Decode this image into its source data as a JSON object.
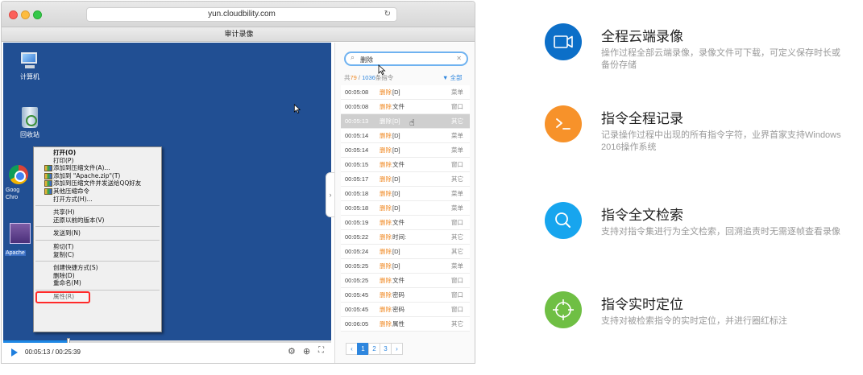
{
  "browser": {
    "url": "yun.cloudbility.com",
    "window_title": "审计录像"
  },
  "desktop": {
    "icons": {
      "computer": "计算机",
      "recycle_bin": "回收站",
      "chrome": "Goog\nChro",
      "zip": "Apache"
    },
    "context_menu": {
      "open": "打开(O)",
      "print": "打印(P)",
      "add_archive": "添加到压缩文件(A)...",
      "add_apache_zip": "添加到 \"Apache.zip\"(T)",
      "add_send_qq": "添加到压缩文件并发送给QQ好友",
      "other_compress": "其他压缩命令",
      "open_with": "打开方式(H)...",
      "share": "共享(H)",
      "restore": "还原以前的版本(V)",
      "send_to": "发送到(N)",
      "cut": "剪切(T)",
      "copy": "复制(C)",
      "create_shortcut": "创建快捷方式(S)",
      "delete": "删除(D)",
      "rename": "重命名(M)",
      "properties": "属性(R)"
    }
  },
  "player": {
    "time": "00:05:13 / 00:25:39",
    "progress_fraction": 0.2,
    "controls": [
      "settings-icon",
      "zoom-icon",
      "fullscreen-icon"
    ]
  },
  "panel": {
    "search_value": "删除",
    "stats_prefix": "共",
    "stats_match": "79",
    "stats_sep": " / ",
    "stats_total": "1036",
    "stats_suffix": "条指令",
    "filter_label": "全部",
    "commands": [
      {
        "time": "00:05:08",
        "keyword": "删除",
        "suffix": "[D]",
        "category": "菜单"
      },
      {
        "time": "00:05:08",
        "keyword": "删除",
        "suffix": "文件",
        "category": "窗口"
      },
      {
        "time": "00:05:13",
        "keyword": "删除",
        "suffix": "[D]",
        "category": "其它",
        "selected": true
      },
      {
        "time": "00:05:14",
        "keyword": "删除",
        "suffix": "[D]",
        "category": "菜单"
      },
      {
        "time": "00:05:14",
        "keyword": "删除",
        "suffix": "[D]",
        "category": "菜单"
      },
      {
        "time": "00:05:15",
        "keyword": "删除",
        "suffix": "文件",
        "category": "窗口"
      },
      {
        "time": "00:05:17",
        "keyword": "删除",
        "suffix": "[D]",
        "category": "其它"
      },
      {
        "time": "00:05:18",
        "keyword": "删除",
        "suffix": "[D]",
        "category": "菜单"
      },
      {
        "time": "00:05:18",
        "keyword": "删除",
        "suffix": "[D]",
        "category": "菜单"
      },
      {
        "time": "00:05:19",
        "keyword": "删除",
        "suffix": "文件",
        "category": "窗口"
      },
      {
        "time": "00:05:22",
        "keyword": "删除",
        "suffix": "时间:",
        "category": "其它"
      },
      {
        "time": "00:05:24",
        "keyword": "删除",
        "suffix": "[D]",
        "category": "其它"
      },
      {
        "time": "00:05:25",
        "keyword": "删除",
        "suffix": "[D]",
        "category": "菜单"
      },
      {
        "time": "00:05:25",
        "keyword": "删除",
        "suffix": "文件",
        "category": "窗口"
      },
      {
        "time": "00:05:45",
        "keyword": "删除",
        "suffix": "密码",
        "category": "窗口"
      },
      {
        "time": "00:05:45",
        "keyword": "删除",
        "suffix": "密码",
        "category": "窗口"
      },
      {
        "time": "00:06:05",
        "keyword": "删除",
        "suffix": "属性",
        "category": "其它"
      }
    ],
    "pager": {
      "prev": "‹",
      "pages": [
        "1",
        "2",
        "3"
      ],
      "next": "›"
    }
  },
  "features": [
    {
      "title": "全程云端录像",
      "desc": "操作过程全部云端录像，录像文件可下载，可定义保存时长或备份存储",
      "color": "#0c6fc8",
      "icon": "video-camera-icon"
    },
    {
      "title": "指令全程记录",
      "desc": "记录操作过程中出现的所有指令字符，业界首家支持Windows 2016操作系统",
      "color": "#f7922a",
      "icon": "terminal-icon"
    },
    {
      "title": "指令全文检索",
      "desc": "支持对指令集进行为全文检索，回溯追责时无需逐帧查看录像",
      "color": "#17a5ee",
      "icon": "search-icon"
    },
    {
      "title": "指令实时定位",
      "desc": "支持对被检索指令的实时定位，并进行圈红标注",
      "color": "#6fbf44",
      "icon": "crosshair-icon"
    }
  ]
}
